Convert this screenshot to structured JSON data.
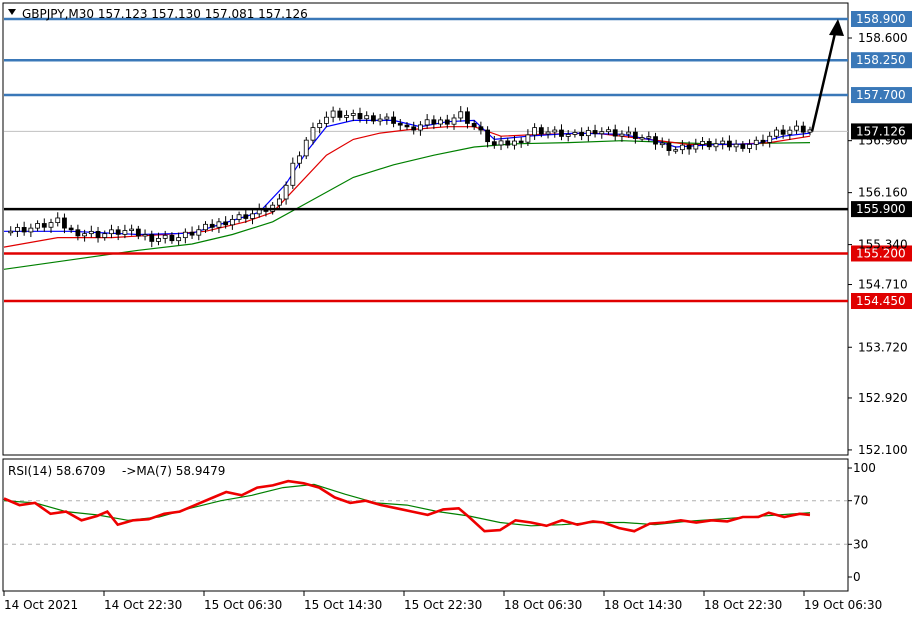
{
  "header": {
    "symbol_line": "GBPJPY,M30  157.123 157.130 157.081 157.126"
  },
  "rsi_header": {
    "rsi_label": "RSI(14) 58.6709",
    "ma_label": "->MA(7) 58.9479"
  },
  "colors": {
    "support_line": "#e00000",
    "resistance_line": "#3a78b8",
    "pivot_line": "#000000",
    "ma_fast": "#0000ff",
    "ma_mid": "#e00000",
    "ma_slow": "#008000",
    "rsi_line": "#ee0000",
    "rsi_ma": "#008000",
    "arrow": "#000000"
  },
  "chart_data": {
    "type": "candlestick",
    "symbol": "GBPJPY",
    "timeframe": "M30",
    "price_axis": {
      "range": [
        152.0,
        159.0
      ],
      "ticks": [
        "158.600",
        "156.980",
        "156.160",
        "155.340",
        "154.710",
        "153.720",
        "152.920",
        "152.100"
      ]
    },
    "current_price": "157.126",
    "horizontal_levels": [
      {
        "price": 158.9,
        "label": "158.900",
        "kind": "resistance"
      },
      {
        "price": 158.25,
        "label": "158.250",
        "kind": "resistance"
      },
      {
        "price": 157.7,
        "label": "157.700",
        "kind": "resistance"
      },
      {
        "price": 155.9,
        "label": "155.900",
        "kind": "pivot"
      },
      {
        "price": 155.2,
        "label": "155.200",
        "kind": "support"
      },
      {
        "price": 154.45,
        "label": "154.450",
        "kind": "support"
      }
    ],
    "time_labels": [
      "14 Oct 2021",
      "14 Oct 22:30",
      "15 Oct 06:30",
      "15 Oct 14:30",
      "15 Oct 22:30",
      "18 Oct 06:30",
      "18 Oct 14:30",
      "18 Oct 22:30",
      "19 Oct 06:30"
    ],
    "price_path": [
      [
        0,
        155.55
      ],
      [
        4,
        155.6
      ],
      [
        8,
        155.7
      ],
      [
        10,
        155.55
      ],
      [
        14,
        155.5
      ],
      [
        18,
        155.55
      ],
      [
        22,
        155.45
      ],
      [
        26,
        155.45
      ],
      [
        30,
        155.6
      ],
      [
        34,
        155.75
      ],
      [
        38,
        155.85
      ],
      [
        41,
        156.0
      ],
      [
        43,
        156.6
      ],
      [
        45,
        157.0
      ],
      [
        47,
        157.3
      ],
      [
        49,
        157.4
      ],
      [
        52,
        157.35
      ],
      [
        55,
        157.35
      ],
      [
        58,
        157.3
      ],
      [
        60,
        157.15
      ],
      [
        63,
        157.25
      ],
      [
        66,
        157.3
      ],
      [
        68,
        157.4
      ],
      [
        70,
        157.2
      ],
      [
        73,
        156.9
      ],
      [
        76,
        156.95
      ],
      [
        79,
        157.15
      ],
      [
        82,
        157.1
      ],
      [
        85,
        157.05
      ],
      [
        88,
        157.15
      ],
      [
        91,
        157.1
      ],
      [
        94,
        157.05
      ],
      [
        97,
        156.95
      ],
      [
        100,
        156.85
      ],
      [
        103,
        156.92
      ],
      [
        106,
        156.92
      ],
      [
        109,
        156.9
      ],
      [
        112,
        156.95
      ],
      [
        115,
        157.1
      ],
      [
        118,
        157.15
      ],
      [
        120,
        157.126
      ]
    ],
    "ma_fast": [
      [
        0,
        155.55
      ],
      [
        10,
        155.55
      ],
      [
        20,
        155.5
      ],
      [
        28,
        155.52
      ],
      [
        34,
        155.72
      ],
      [
        38,
        155.85
      ],
      [
        42,
        156.3
      ],
      [
        45,
        156.8
      ],
      [
        48,
        157.2
      ],
      [
        52,
        157.3
      ],
      [
        58,
        157.3
      ],
      [
        62,
        157.2
      ],
      [
        66,
        157.28
      ],
      [
        70,
        157.3
      ],
      [
        73,
        157.0
      ],
      [
        78,
        157.05
      ],
      [
        85,
        157.1
      ],
      [
        92,
        157.08
      ],
      [
        97,
        156.98
      ],
      [
        100,
        156.88
      ],
      [
        106,
        156.92
      ],
      [
        112,
        156.93
      ],
      [
        116,
        157.05
      ],
      [
        120,
        157.1
      ]
    ],
    "ma_mid": [
      [
        0,
        155.3
      ],
      [
        8,
        155.45
      ],
      [
        16,
        155.45
      ],
      [
        24,
        155.5
      ],
      [
        30,
        155.55
      ],
      [
        36,
        155.7
      ],
      [
        40,
        155.85
      ],
      [
        44,
        156.3
      ],
      [
        48,
        156.75
      ],
      [
        52,
        157.0
      ],
      [
        56,
        157.1
      ],
      [
        60,
        157.15
      ],
      [
        66,
        157.2
      ],
      [
        70,
        157.2
      ],
      [
        74,
        157.05
      ],
      [
        80,
        157.08
      ],
      [
        88,
        157.1
      ],
      [
        96,
        157.0
      ],
      [
        102,
        156.92
      ],
      [
        108,
        156.92
      ],
      [
        114,
        156.95
      ],
      [
        120,
        157.05
      ]
    ],
    "ma_slow": [
      [
        0,
        154.95
      ],
      [
        10,
        155.1
      ],
      [
        20,
        155.25
      ],
      [
        28,
        155.35
      ],
      [
        34,
        155.5
      ],
      [
        40,
        155.7
      ],
      [
        46,
        156.05
      ],
      [
        52,
        156.4
      ],
      [
        58,
        156.6
      ],
      [
        64,
        156.75
      ],
      [
        70,
        156.88
      ],
      [
        76,
        156.93
      ],
      [
        84,
        156.95
      ],
      [
        92,
        156.98
      ],
      [
        100,
        156.95
      ],
      [
        108,
        156.92
      ],
      [
        114,
        156.94
      ],
      [
        120,
        156.95
      ]
    ],
    "forecast_arrow": {
      "from_price": 157.126,
      "to_price": 158.9
    },
    "rsi": {
      "range": [
        0,
        100
      ],
      "ticks": [
        "100",
        "70",
        "30",
        "0"
      ],
      "levels": [
        70,
        30
      ],
      "value": 58.6709,
      "ma_value": 58.9479,
      "rsi_path": [
        [
          0,
          72
        ],
        [
          3,
          66
        ],
        [
          6,
          68
        ],
        [
          9,
          58
        ],
        [
          12,
          60
        ],
        [
          15,
          52
        ],
        [
          18,
          56
        ],
        [
          20,
          60
        ],
        [
          22,
          48
        ],
        [
          25,
          52
        ],
        [
          28,
          53
        ],
        [
          31,
          58
        ],
        [
          34,
          60
        ],
        [
          37,
          66
        ],
        [
          40,
          72
        ],
        [
          43,
          78
        ],
        [
          46,
          75
        ],
        [
          49,
          82
        ],
        [
          52,
          84
        ],
        [
          55,
          88
        ],
        [
          58,
          86
        ],
        [
          61,
          82
        ],
        [
          64,
          73
        ],
        [
          67,
          68
        ],
        [
          70,
          70
        ],
        [
          73,
          66
        ],
        [
          76,
          63
        ],
        [
          79,
          60
        ],
        [
          82,
          57
        ],
        [
          85,
          62
        ],
        [
          88,
          63
        ],
        [
          90,
          55
        ],
        [
          93,
          42
        ],
        [
          96,
          43
        ],
        [
          99,
          52
        ],
        [
          102,
          50
        ],
        [
          105,
          47
        ],
        [
          108,
          52
        ],
        [
          111,
          48
        ],
        [
          114,
          51
        ],
        [
          116,
          50
        ],
        [
          119,
          45
        ],
        [
          122,
          42
        ],
        [
          125,
          49
        ],
        [
          128,
          50
        ],
        [
          131,
          52
        ],
        [
          134,
          50
        ],
        [
          137,
          52
        ],
        [
          140,
          51
        ],
        [
          143,
          55
        ],
        [
          146,
          55
        ],
        [
          148,
          59
        ],
        [
          151,
          55
        ],
        [
          154,
          58
        ],
        [
          156,
          57
        ]
      ],
      "ma_path": [
        [
          0,
          70
        ],
        [
          6,
          68
        ],
        [
          12,
          60
        ],
        [
          18,
          57
        ],
        [
          24,
          52
        ],
        [
          30,
          55
        ],
        [
          36,
          63
        ],
        [
          42,
          70
        ],
        [
          48,
          75
        ],
        [
          54,
          82
        ],
        [
          60,
          85
        ],
        [
          66,
          76
        ],
        [
          72,
          68
        ],
        [
          78,
          66
        ],
        [
          84,
          60
        ],
        [
          90,
          56
        ],
        [
          96,
          50
        ],
        [
          102,
          47
        ],
        [
          108,
          48
        ],
        [
          114,
          50
        ],
        [
          120,
          50
        ],
        [
          126,
          48
        ],
        [
          132,
          51
        ],
        [
          138,
          53
        ],
        [
          144,
          55
        ],
        [
          150,
          57
        ],
        [
          156,
          59
        ]
      ]
    }
  }
}
